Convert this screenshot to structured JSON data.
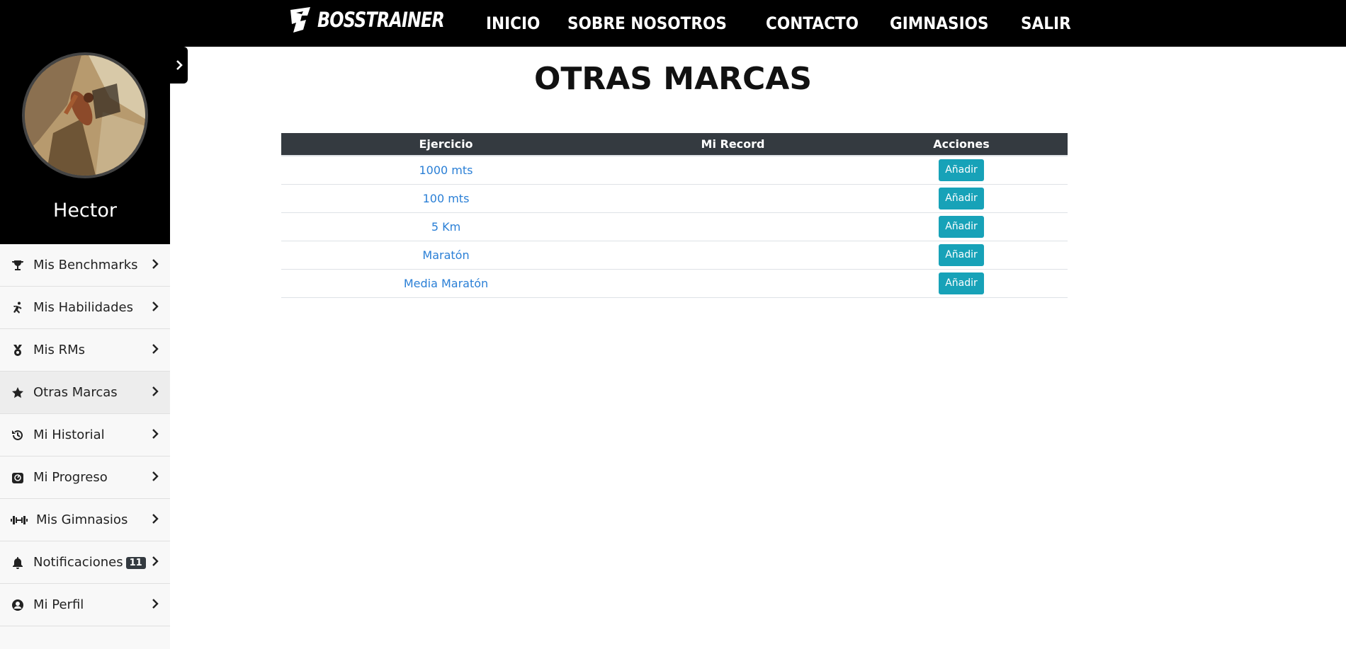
{
  "brand": {
    "logo_text": "BOSSTRAINER"
  },
  "nav": [
    {
      "label": "INICIO"
    },
    {
      "label": "SOBRE NOSOTROS"
    },
    {
      "label": "CONTACTO"
    },
    {
      "label": "GIMNASIOS"
    },
    {
      "label": "SALIR"
    }
  ],
  "user": {
    "name": "Hector"
  },
  "sidebar": {
    "items": [
      {
        "label": "Mis Benchmarks",
        "icon": "trophy-icon"
      },
      {
        "label": "Mis Habilidades",
        "icon": "running-icon"
      },
      {
        "label": "Mis RMs",
        "icon": "medal-icon"
      },
      {
        "label": "Otras Marcas",
        "icon": "star-icon",
        "active": true
      },
      {
        "label": "Mi Historial",
        "icon": "history-icon"
      },
      {
        "label": "Mi Progreso",
        "icon": "progress-icon"
      },
      {
        "label": "Mis Gimnasios",
        "icon": "dumbbell-icon"
      },
      {
        "label": "Notificaciones",
        "icon": "bell-icon",
        "badge": "11"
      },
      {
        "label": "Mi Perfil",
        "icon": "user-circle-icon"
      }
    ]
  },
  "main": {
    "title": "OTRAS MARCAS",
    "table": {
      "headers": [
        "Ejercicio",
        "Mi Record",
        "Acciones"
      ],
      "rows": [
        {
          "exercise": "1000 mts",
          "record": "",
          "action": "Añadir"
        },
        {
          "exercise": "100 mts",
          "record": "",
          "action": "Añadir"
        },
        {
          "exercise": "5 Km",
          "record": "",
          "action": "Añadir"
        },
        {
          "exercise": "Maratón",
          "record": "",
          "action": "Añadir"
        },
        {
          "exercise": "Media Maratón",
          "record": "",
          "action": "Añadir"
        }
      ]
    }
  },
  "colors": {
    "accent": "#17a2b8",
    "link": "#2a7fd6",
    "header_bg": "#343a40"
  }
}
